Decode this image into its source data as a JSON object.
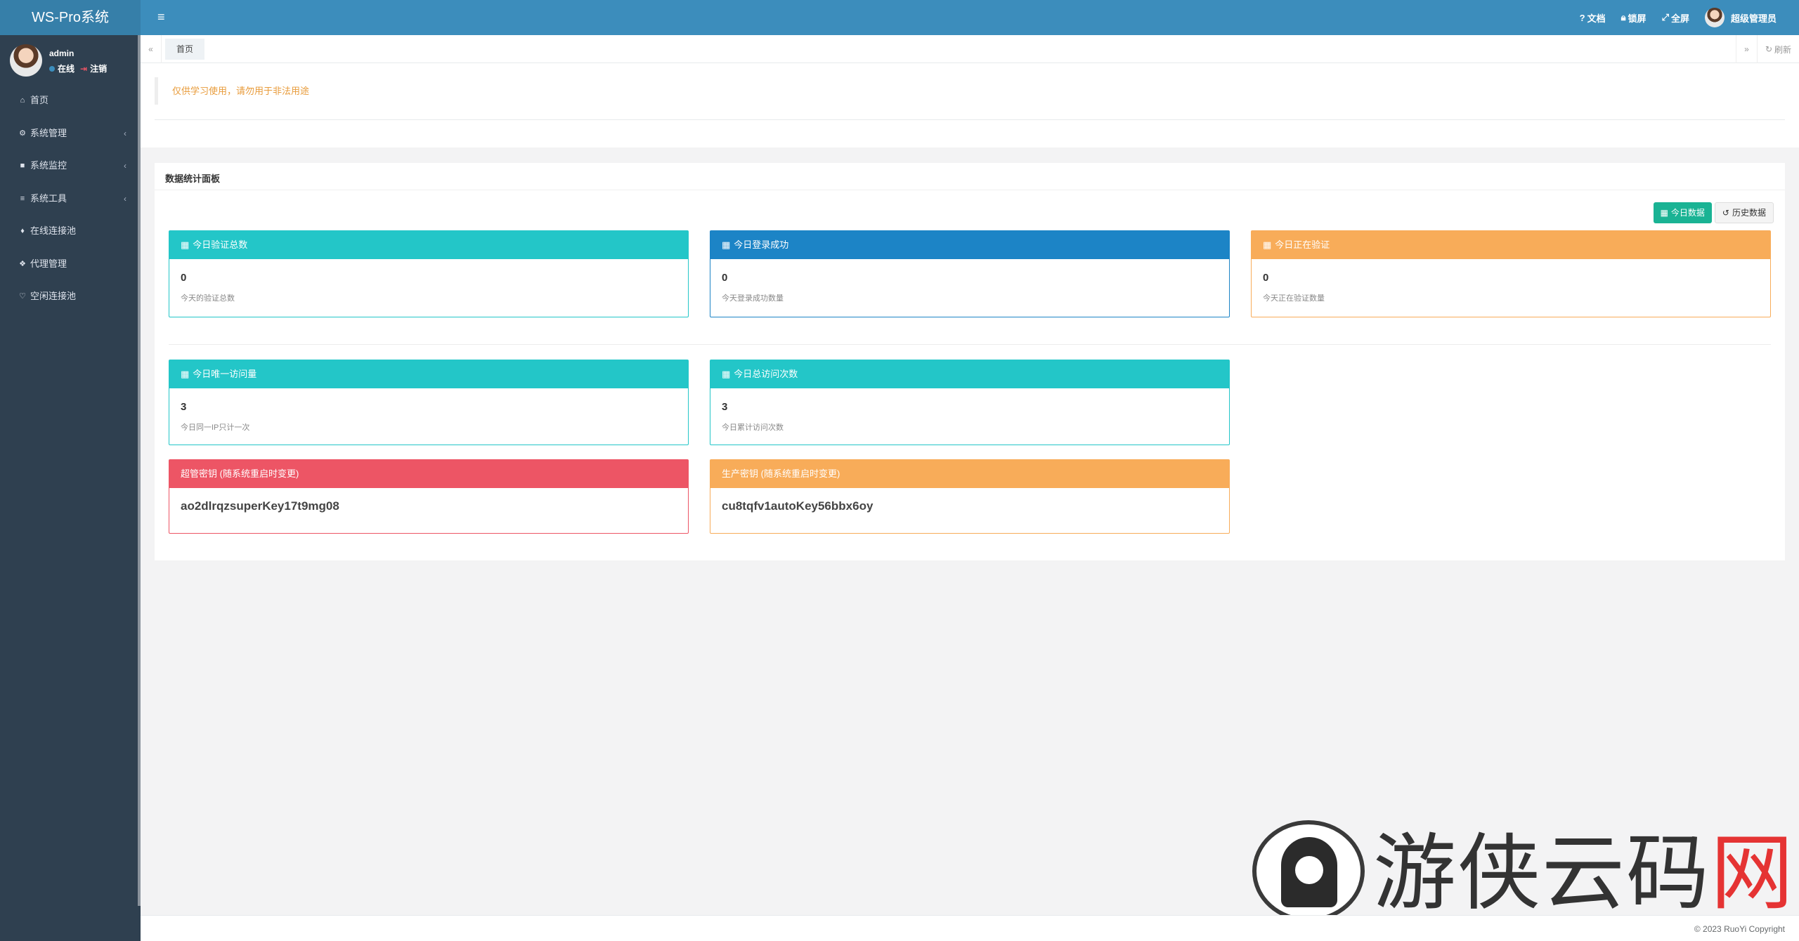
{
  "app": {
    "title": "WS-Pro系统"
  },
  "user": {
    "name": "admin",
    "status_online": "在线",
    "logout": "注销"
  },
  "sidebar": {
    "items": [
      {
        "label": "首页",
        "icon": "home-icon",
        "has_arrow": false
      },
      {
        "label": "系统管理",
        "icon": "gear-icon",
        "has_arrow": true
      },
      {
        "label": "系统监控",
        "icon": "video-camera-icon",
        "has_arrow": true
      },
      {
        "label": "系统工具",
        "icon": "bars-icon",
        "has_arrow": true
      },
      {
        "label": "在线连接池",
        "icon": "diamond-icon",
        "has_arrow": false
      },
      {
        "label": "代理管理",
        "icon": "paw-icon",
        "has_arrow": false
      },
      {
        "label": "空闲连接池",
        "icon": "heart-icon",
        "has_arrow": false
      }
    ]
  },
  "topbar": {
    "docs": "文档",
    "lock": "锁屏",
    "fullscreen": "全屏",
    "admin": "超级管理员"
  },
  "tabs": {
    "home": "首页",
    "refresh": "刷新"
  },
  "notice": "仅供学习使用，请勿用于非法用途",
  "panel": {
    "title": "数据统计面板",
    "btn_today": "今日数据",
    "btn_history": "历史数据"
  },
  "cards": [
    {
      "title": "今日验证总数",
      "value": "0",
      "desc": "今天的验证总数",
      "color": "#23c6c8"
    },
    {
      "title": "今日登录成功",
      "value": "0",
      "desc": "今天登录成功数量",
      "color": "#1c84c6"
    },
    {
      "title": "今日正在验证",
      "value": "0",
      "desc": "今天正在验证数量",
      "color": "#f8ac59"
    },
    {
      "title": "今日唯一访问量",
      "value": "3",
      "desc": "今日同一IP只计一次",
      "color": "#23c6c8"
    },
    {
      "title": "今日总访问次数",
      "value": "3",
      "desc": "今日累计访问次数",
      "color": "#23c6c8"
    }
  ],
  "keys": [
    {
      "title": "超管密钥 (随系统重启时变更)",
      "value": "ao2dlrqzsuperKey17t9mg08",
      "color": "#ed5565"
    },
    {
      "title": "生产密钥 (随系统重启时变更)",
      "value": "cu8tqfv1autoKey56bbx6oy",
      "color": "#f8ac59"
    }
  ],
  "footer": {
    "copyright": "© 2023 RuoYi Copyright"
  },
  "watermark": {
    "text_main": "游侠云码",
    "text_accent": "网"
  }
}
